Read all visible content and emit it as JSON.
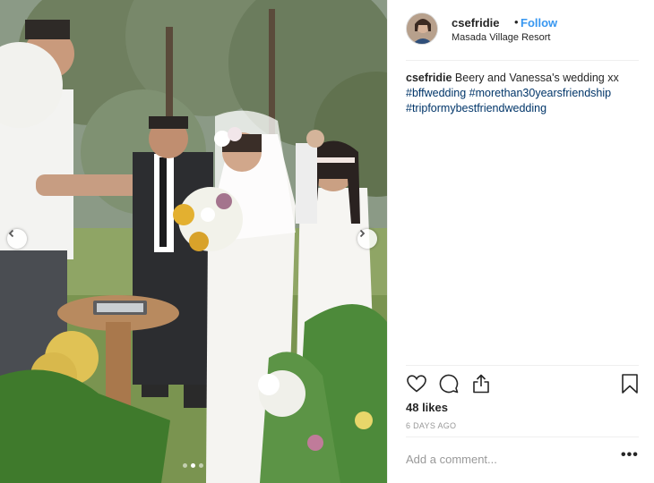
{
  "post": {
    "username": "csefridie",
    "separator": "•",
    "follow_label": "Follow",
    "location": "Masada Village Resort",
    "caption": {
      "username": "csefridie",
      "text": "Beery and Vanessa's wedding xx",
      "hashtags": [
        "#bffwedding",
        "#morethan30yearsfriendship",
        "#tripformybestfriendwedding"
      ]
    },
    "likes": "48 likes",
    "time_ago": "6 DAYS AGO",
    "comment_placeholder": "Add a comment...",
    "more_label": "•••"
  },
  "carousel": {
    "slide_count": 3,
    "active_slide": 2
  },
  "colors": {
    "link": "#3897f0",
    "hashtag": "#003569",
    "muted": "#999999",
    "text": "#262626",
    "divider": "#efefef"
  },
  "icons": [
    "heart-icon",
    "comment-icon",
    "share-icon",
    "bookmark-icon",
    "chevron-left-icon",
    "chevron-right-icon"
  ]
}
